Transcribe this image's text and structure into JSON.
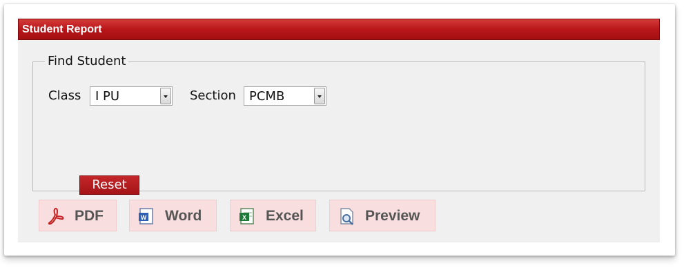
{
  "panel": {
    "title": "Student Report"
  },
  "find_student": {
    "legend": "Find Student",
    "class_label": "Class",
    "class_value": "I PU",
    "section_label": "Section",
    "section_value": "PCMB",
    "reset_label": "Reset"
  },
  "exports": [
    {
      "label": "PDF",
      "icon": "pdf-icon"
    },
    {
      "label": "Word",
      "icon": "word-icon"
    },
    {
      "label": "Excel",
      "icon": "excel-icon"
    },
    {
      "label": "Preview",
      "icon": "preview-icon"
    }
  ],
  "colors": {
    "title_bar": "#b9171a",
    "reset_button": "#a51417",
    "export_button_bg": "#f8dede"
  }
}
